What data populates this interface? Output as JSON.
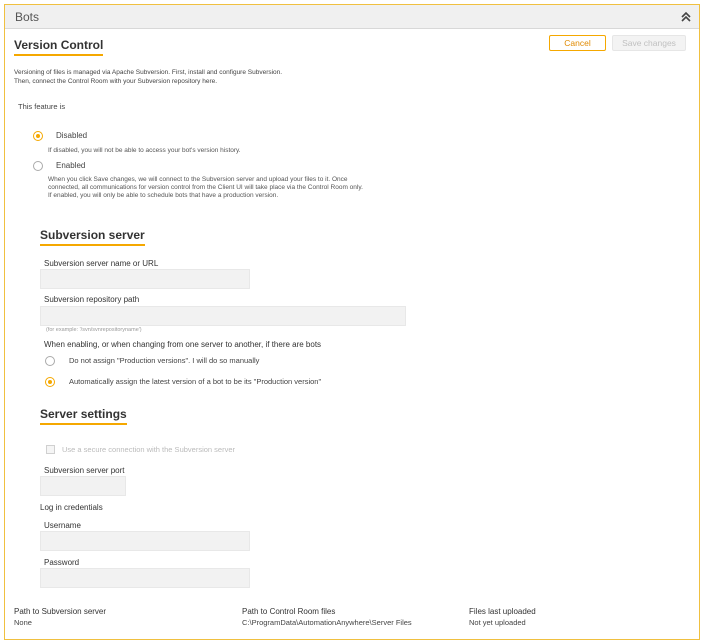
{
  "panel": {
    "title": "Bots"
  },
  "version_control": {
    "title": "Version Control",
    "cancel_label": "Cancel",
    "save_label": "Save changes",
    "intro_line1": "Versioning of files is managed via Apache Subversion. First, install and configure Subversion.",
    "intro_line2": "Then, connect the Control Room with your Subversion repository here.",
    "feature_label": "This feature is",
    "options": [
      {
        "label": "Disabled",
        "selected": true,
        "help": "If disabled, you will not be able to access your bot's version history."
      },
      {
        "label": "Enabled",
        "selected": false,
        "help": "When you click Save changes, we will connect to the Subversion server and upload your files to it. Once connected, all communications for version control from the Client UI will take place via the Control Room only. If enabled, you will only be able to schedule bots that have a production version."
      }
    ]
  },
  "subversion_server": {
    "title": "Subversion server",
    "server_label": "Subversion server name or URL",
    "server_value": "",
    "repo_label": "Subversion repository path",
    "repo_value": "",
    "repo_hint": "(for example: '/svn/svnrepositoryname')",
    "assign_label": "When enabling, or when changing from one server to another, if there are bots",
    "assign_options": [
      {
        "label": "Do not assign \"Production versions\". I will do so manually",
        "selected": false
      },
      {
        "label": "Automatically assign the latest version of a bot to be its \"Production version\"",
        "selected": true
      }
    ]
  },
  "server_settings": {
    "title": "Server settings",
    "secure_label": "Use a secure connection with the Subversion server",
    "secure_checked": false,
    "port_label": "Subversion server port",
    "port_value": "",
    "credentials_label": "Log in credentials",
    "username_label": "Username",
    "username_value": "",
    "password_label": "Password",
    "password_value": ""
  },
  "footer": {
    "path_svn_label": "Path to Subversion server",
    "path_svn_value": "None",
    "path_cr_label": "Path to Control Room files",
    "path_cr_value": "C:\\ProgramData\\AutomationAnywhere\\Server Files",
    "last_uploaded_label": "Files last uploaded",
    "last_uploaded_value": "Not yet uploaded"
  },
  "colors": {
    "accent": "#f5a800",
    "border": "#f0c040",
    "header_bg": "#f0f0f0"
  },
  "icons": {
    "collapse": "double-chevron-up-icon"
  }
}
